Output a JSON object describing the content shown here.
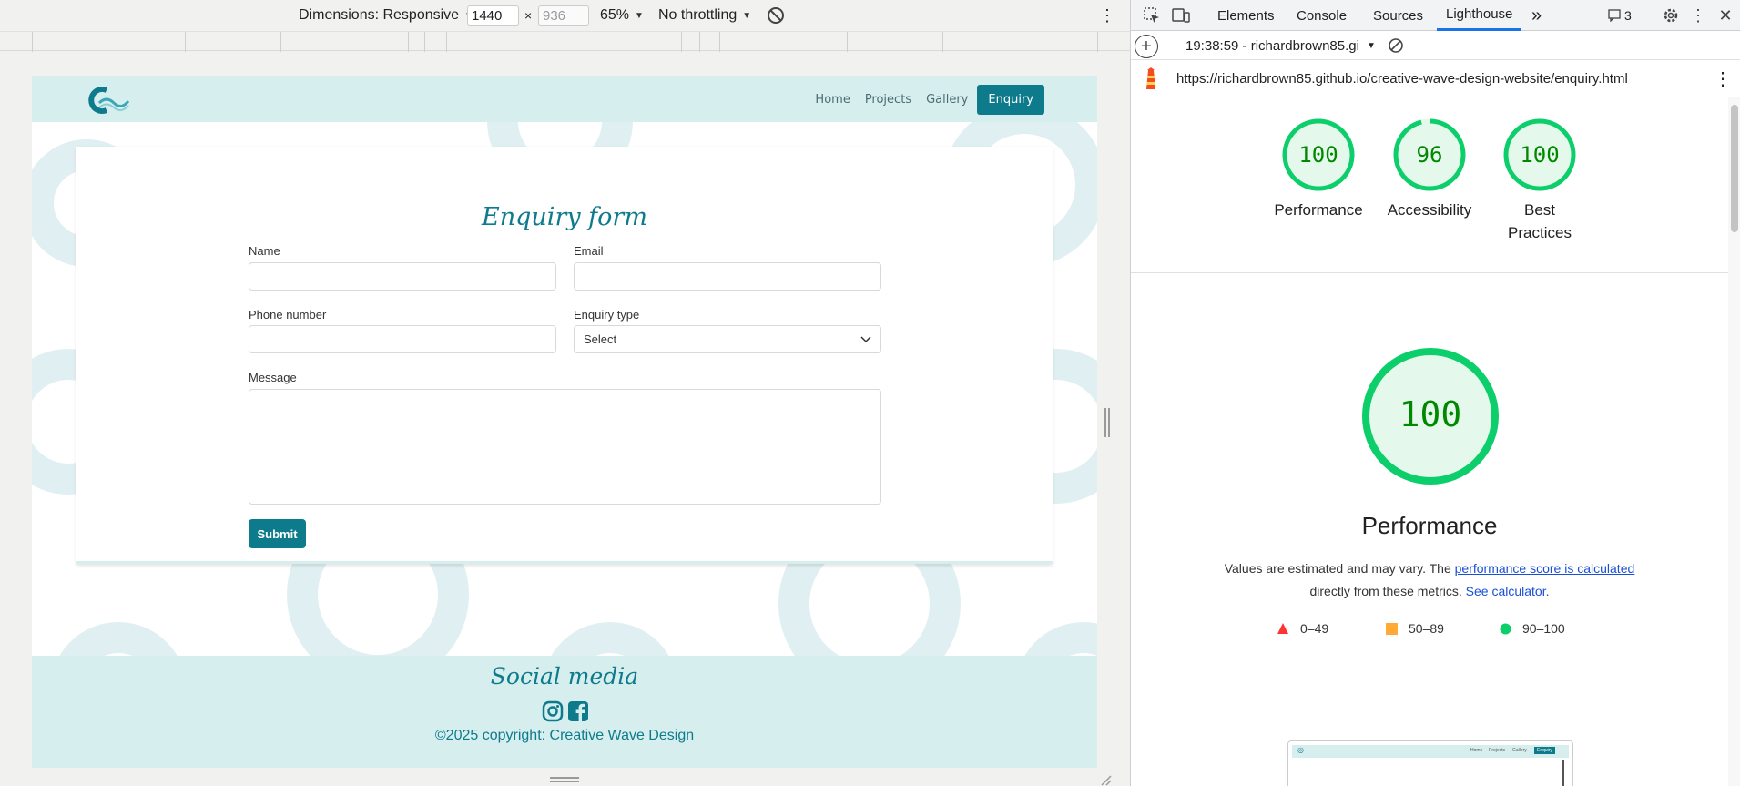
{
  "device_toolbar": {
    "dimensions_label": "Dimensions: Responsive",
    "width_value": "1440",
    "height_placeholder": "936",
    "times_symbol": "×",
    "zoom": "65%",
    "throttling": "No throttling"
  },
  "site": {
    "nav": [
      "Home",
      "Projects",
      "Gallery",
      "Enquiry"
    ],
    "form_title": "Enquiry form",
    "labels": {
      "name": "Name",
      "email": "Email",
      "phone": "Phone number",
      "enquiry_type": "Enquiry type",
      "message": "Message"
    },
    "select_value": "Select",
    "submit_label": "Submit",
    "footer_title": "Social media",
    "copyright": "©2025 copyright: Creative Wave Design"
  },
  "devtools": {
    "tabs": [
      "Elements",
      "Console",
      "Sources",
      "Lighthouse"
    ],
    "more_tabs": "»",
    "issues_count": "3",
    "report_selector": "19:38:59 - richardbrown85.gi",
    "url": "https://richardbrown85.github.io/creative-wave-design-website/enquiry.html",
    "scores": [
      {
        "value": "100",
        "score": 100,
        "label": "Performance",
        "color": "#0cce6b"
      },
      {
        "value": "96",
        "score": 96,
        "label": "Accessibility",
        "color": "#0cce6b"
      },
      {
        "value": "100",
        "score": 100,
        "label": "Best Practices",
        "color": "#0cce6b"
      }
    ],
    "big_score": {
      "value": "100",
      "score": 100,
      "title": "Performance"
    },
    "perf_note_prefix": "Values are estimated and may vary. The",
    "perf_note_link1": "performance score is calculated",
    "perf_note_middle": "directly from these metrics.",
    "perf_note_link2": "See calculator.",
    "legend": [
      {
        "range": "0–49",
        "shape": "triangle",
        "color": "#ff3333"
      },
      {
        "range": "50–89",
        "shape": "square",
        "color": "#ffaa33"
      },
      {
        "range": "90–100",
        "shape": "circle",
        "color": "#0cce6b"
      }
    ],
    "thumb_nav": [
      "Home",
      "Projects",
      "Gallery",
      "Enquiry"
    ]
  }
}
